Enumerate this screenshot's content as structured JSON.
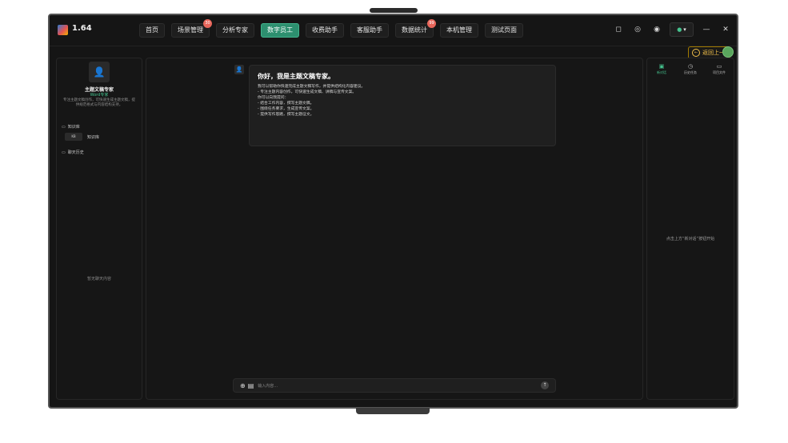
{
  "app": {
    "version": "1.64"
  },
  "nav": {
    "tabs": [
      {
        "label": "首页"
      },
      {
        "label": "场景管理",
        "badge": "30"
      },
      {
        "label": "分析专家"
      },
      {
        "label": "数字员工",
        "active": true
      },
      {
        "label": "收费助手"
      },
      {
        "label": "客服助手"
      },
      {
        "label": "数据统计",
        "badge": "99"
      },
      {
        "label": "本机管理"
      },
      {
        "label": "测试页面"
      }
    ]
  },
  "left": {
    "agent_name": "主题文稿专家",
    "agent_role": "Word专家",
    "agent_desc": "专注主题文稿创作，可快速生成主题文稿，提供规范格式与内容结构支持。",
    "knowledge_label": "知识库",
    "knowledge_item": "知识库",
    "history_label": "聊天历史",
    "empty_label": "暂无聊天内容"
  },
  "center": {
    "title": "你好，我是主题文稿专家。",
    "lines": [
      "我可以帮助你快速完成主题文稿写作，并提供结构化内容建议。",
      "- 专注主题内容创作，可快速生成文稿、讲稿与宣传文案。",
      "你可以向我提问：",
      "- 结合工作内容，撰写主题文稿。",
      "- 围绕任务要求，生成宣传文案。",
      "- 提供写作思路，撰写主题征文。"
    ],
    "input_placeholder": "输入内容..."
  },
  "right": {
    "tabs": [
      {
        "label": "新对话",
        "active": true
      },
      {
        "label": "历史任务"
      },
      {
        "label": "项目文件"
      }
    ],
    "empty_hint": "点击上方“新对话”按钮开始"
  },
  "back_button": {
    "label": "返回上一"
  },
  "colors": {
    "accent": "#2d8f6f",
    "accent_light": "#45c28e",
    "badge": "#e8665b",
    "panel": "#161616",
    "back": "#f4c24a"
  }
}
